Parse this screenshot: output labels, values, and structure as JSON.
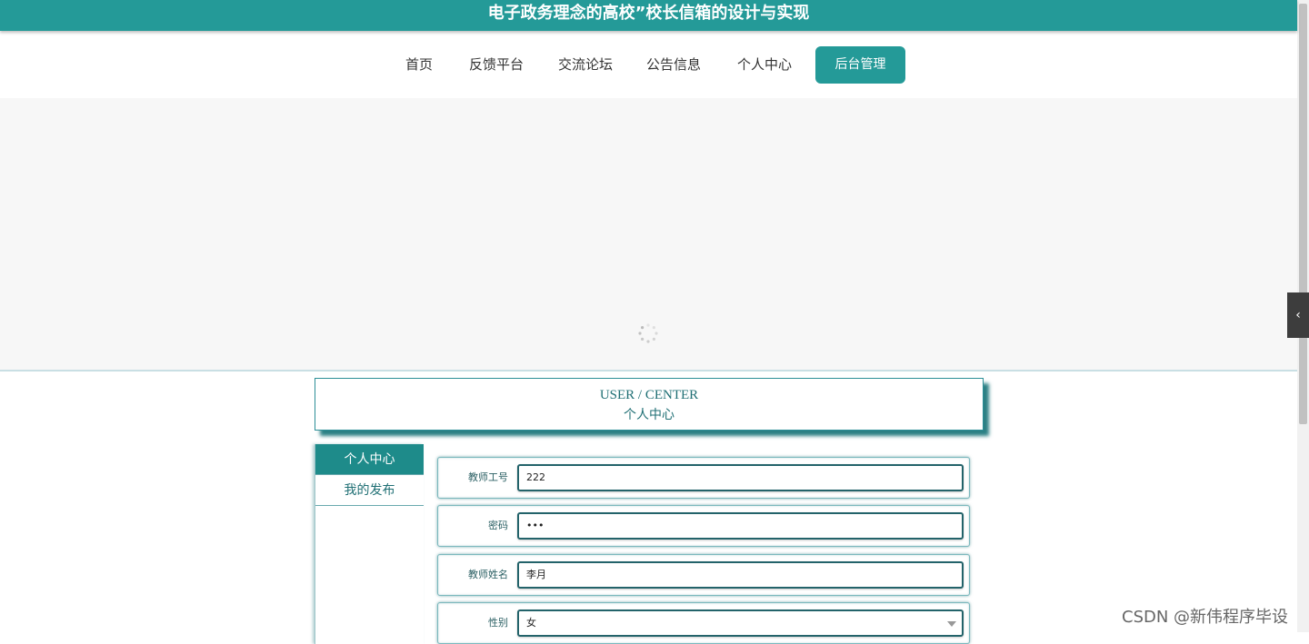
{
  "header": {
    "title": "电子政务理念的高校”校长信箱的设计与实现"
  },
  "nav": {
    "items": [
      "首页",
      "反馈平台",
      "交流论坛",
      "公告信息",
      "个人中心",
      "后台管理"
    ],
    "active_index": 5
  },
  "section": {
    "title_en": "USER / CENTER",
    "title_cn": "个人中心"
  },
  "sidebar": {
    "items": [
      "个人中心",
      "我的发布"
    ],
    "active_index": 0
  },
  "form": {
    "fields": [
      {
        "label": "教师工号",
        "value": "222",
        "type": "text"
      },
      {
        "label": "密码",
        "value": "•••",
        "type": "password"
      },
      {
        "label": "教师姓名",
        "value": "李月",
        "type": "text"
      },
      {
        "label": "性别",
        "value": "女",
        "type": "select"
      }
    ]
  },
  "side_tab": {
    "icon": "chevron-left-icon",
    "glyph": "‹"
  },
  "watermark": "CSDN @新伟程序毕设",
  "colors": {
    "brand": "#249a98",
    "accent_dark": "#23636a"
  }
}
